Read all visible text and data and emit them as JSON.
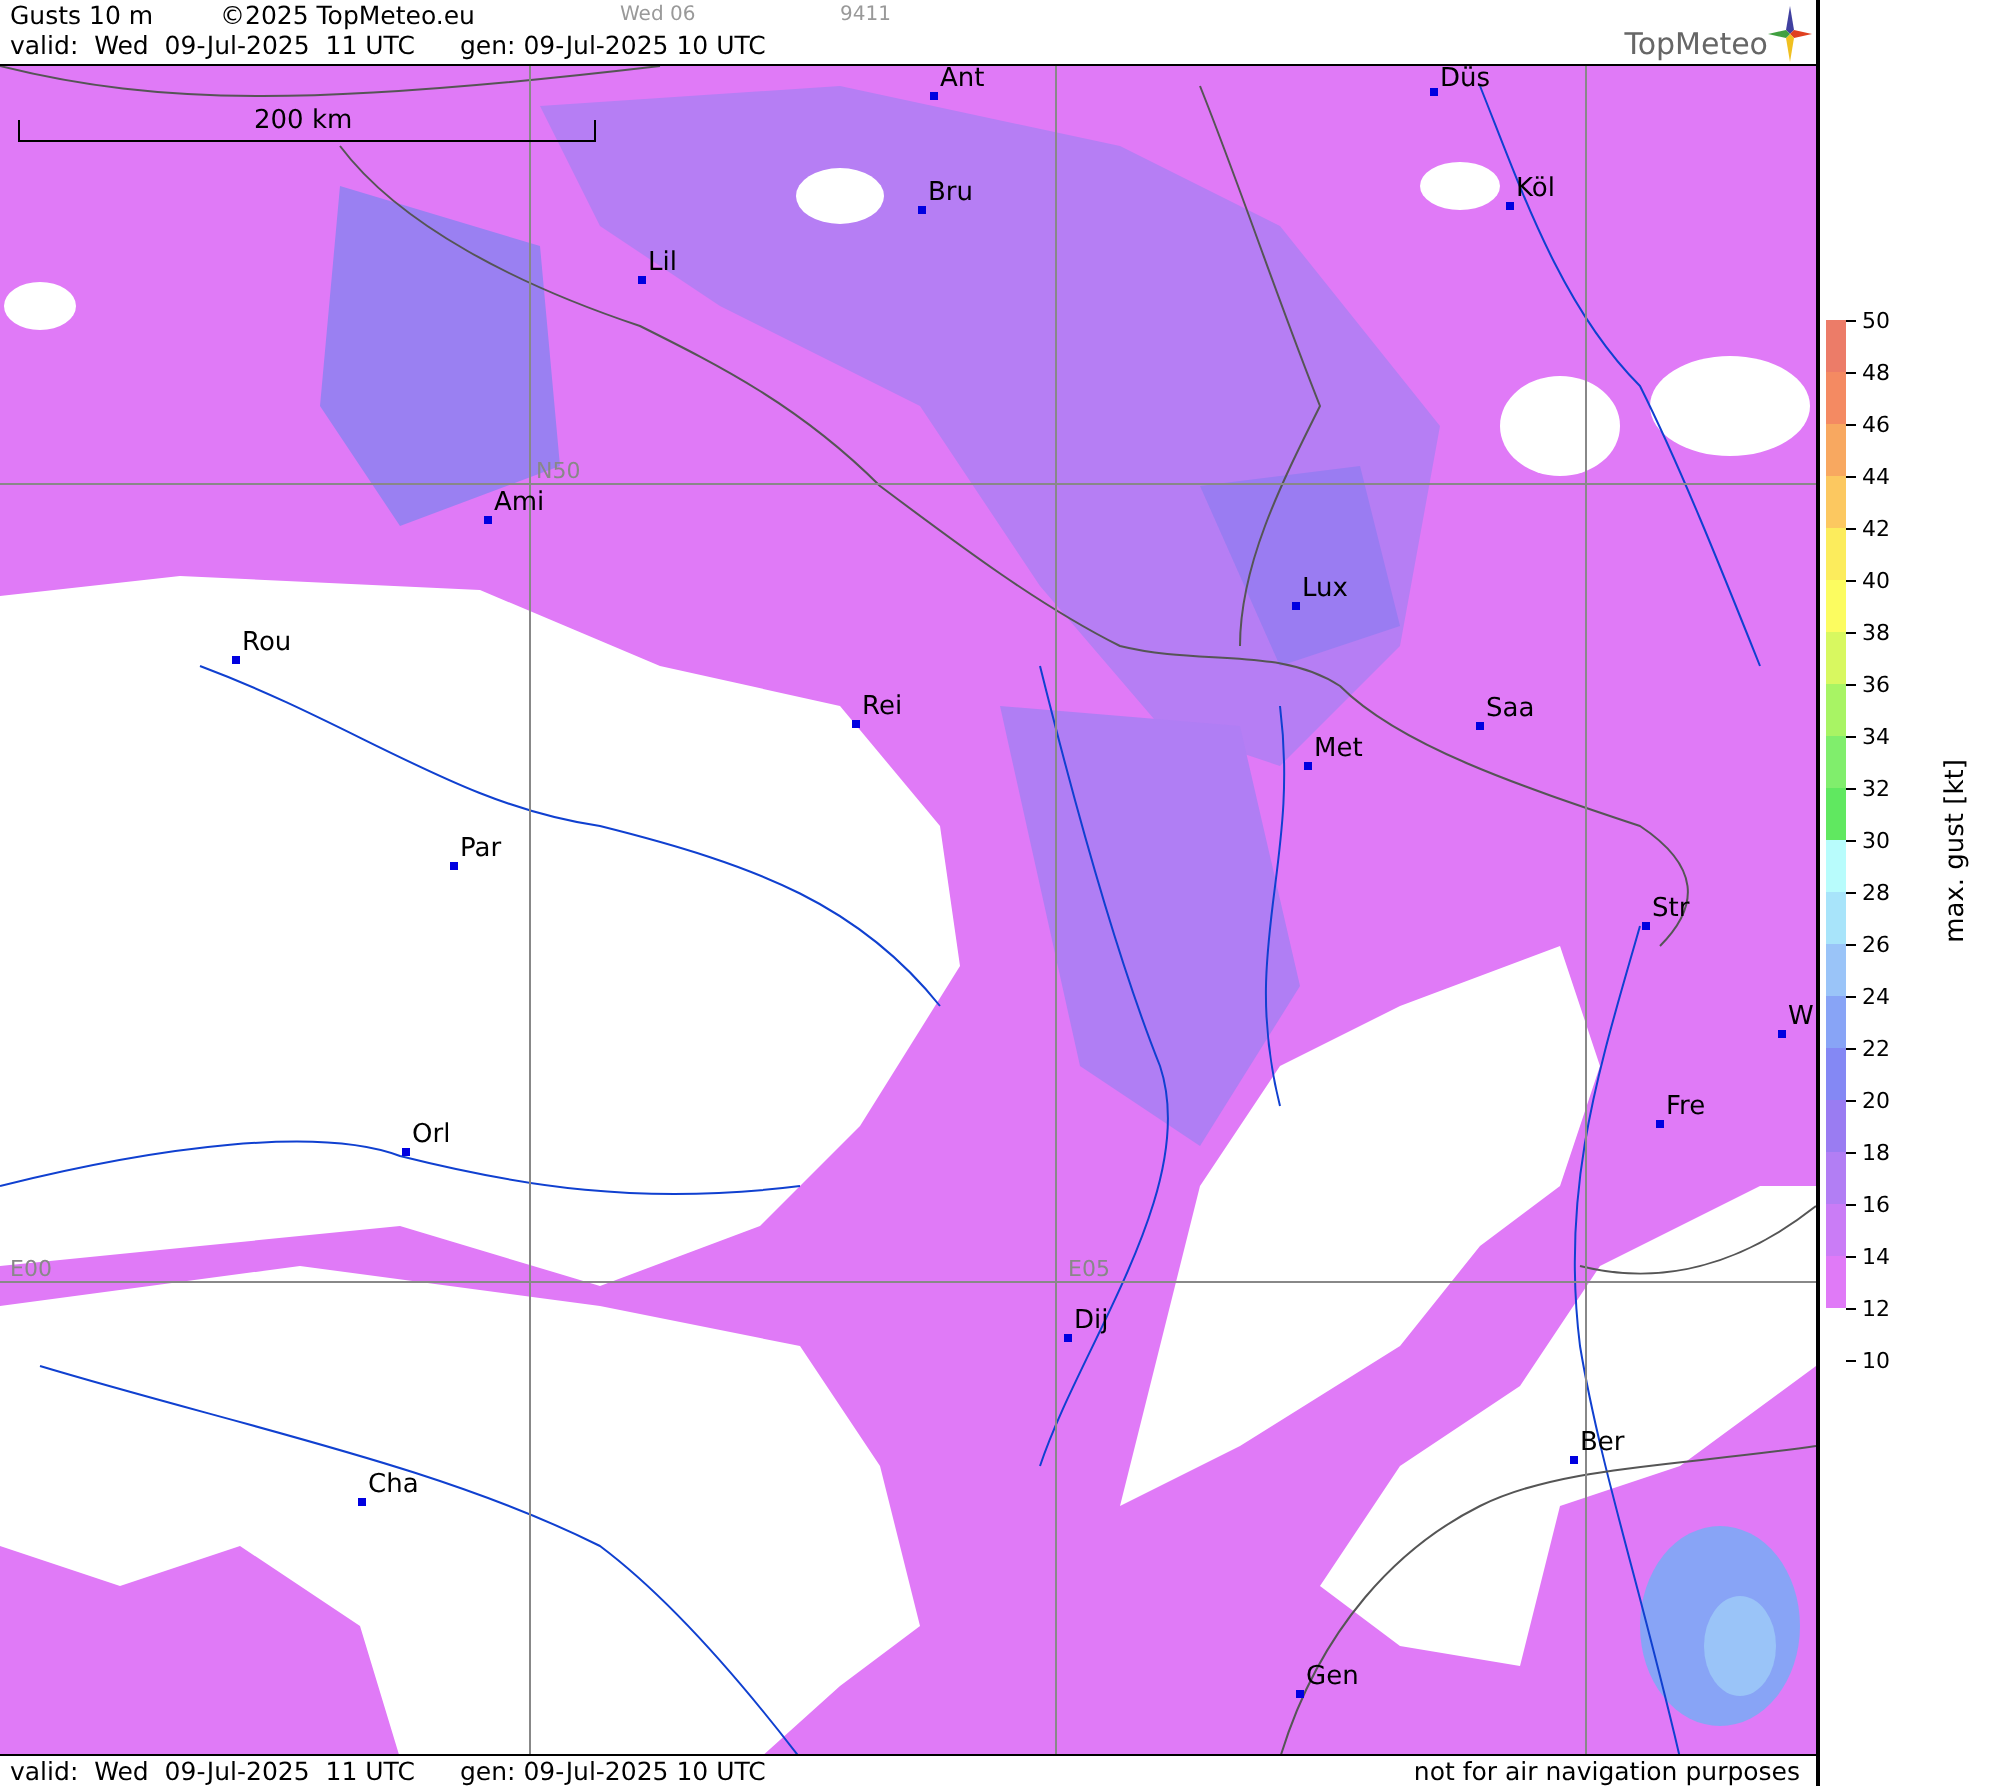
{
  "header": {
    "title": "Gusts 10 m",
    "copyright": "©2025 TopMeteo.eu",
    "day": "Wed 06",
    "code": "9411",
    "valid": "valid:  Wed  09-Jul-2025  11 UTC",
    "generated": "gen: 09-Jul-2025 10 UTC",
    "logo": "TopMeteo"
  },
  "map": {
    "scale": "200 km",
    "grid_labels": [
      "N50",
      "E00",
      "E05"
    ],
    "cities": [
      {
        "name": "Ant"
      },
      {
        "name": "Düs"
      },
      {
        "name": "Bru"
      },
      {
        "name": "Köl"
      },
      {
        "name": "Lil"
      },
      {
        "name": "Ami"
      },
      {
        "name": "Lux"
      },
      {
        "name": "Rou"
      },
      {
        "name": "Saa"
      },
      {
        "name": "Rei"
      },
      {
        "name": "Met"
      },
      {
        "name": "Par"
      },
      {
        "name": "Str"
      },
      {
        "name": "W"
      },
      {
        "name": "Fre"
      },
      {
        "name": "Orl"
      },
      {
        "name": "Dij"
      },
      {
        "name": "Ber"
      },
      {
        "name": "Cha"
      },
      {
        "name": "Gen"
      }
    ]
  },
  "legend": {
    "title": "max. gust [kt]",
    "ticks": [
      "50",
      "48",
      "46",
      "44",
      "42",
      "40",
      "38",
      "36",
      "34",
      "32",
      "30",
      "28",
      "26",
      "24",
      "22",
      "20",
      "18",
      "16",
      "14",
      "12",
      "10"
    ],
    "bands": [
      {
        "color": "#ec7c68"
      },
      {
        "color": "#f48a62"
      },
      {
        "color": "#f8a860"
      },
      {
        "color": "#fcc860"
      },
      {
        "color": "#fcec5c"
      },
      {
        "color": "#fcfc60"
      },
      {
        "color": "#d8f860"
      },
      {
        "color": "#a8f464"
      },
      {
        "color": "#80ee6c"
      },
      {
        "color": "#60e860"
      },
      {
        "color": "#b8fcfc"
      },
      {
        "color": "#a8e4fa"
      },
      {
        "color": "#9ac4f8"
      },
      {
        "color": "#88a4f6"
      },
      {
        "color": "#8488f4"
      },
      {
        "color": "#9a7cf2"
      },
      {
        "color": "#b27ef4"
      },
      {
        "color": "#ca7cf6"
      },
      {
        "color": "#e07af7"
      }
    ]
  },
  "footer": {
    "valid": "valid:  Wed  09-Jul-2025  11 UTC",
    "generated": "gen: 09-Jul-2025 10 UTC",
    "disclaimer": "not for air navigation purposes"
  }
}
